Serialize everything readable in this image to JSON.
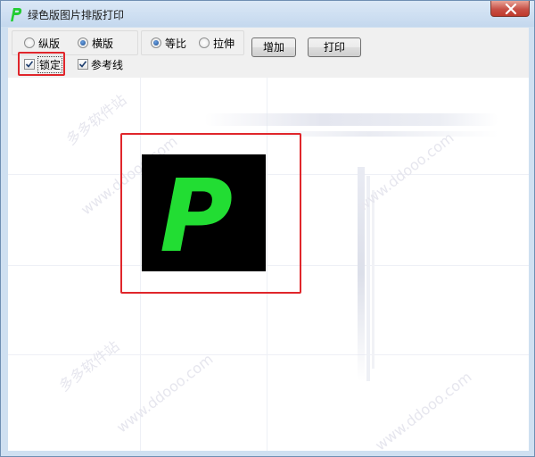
{
  "window": {
    "title": "绿色版图片排版打印",
    "icon": "app-p-logo-icon",
    "accent_color": "#22dd33"
  },
  "orientation": {
    "options": [
      "纵版",
      "横版"
    ],
    "selected": "横版"
  },
  "scaling": {
    "options": [
      "等比",
      "拉伸"
    ],
    "selected": "等比"
  },
  "checkboxes": {
    "lock": {
      "label": "锁定",
      "checked": true
    },
    "guides": {
      "label": "参考线",
      "checked": true
    }
  },
  "buttons": {
    "add": "增加",
    "print": "打印"
  },
  "canvas": {
    "tile_letter": "P",
    "tile_letter_color": "#22dd33",
    "tile_background": "#000000"
  },
  "annotation_color": "#e0262b"
}
